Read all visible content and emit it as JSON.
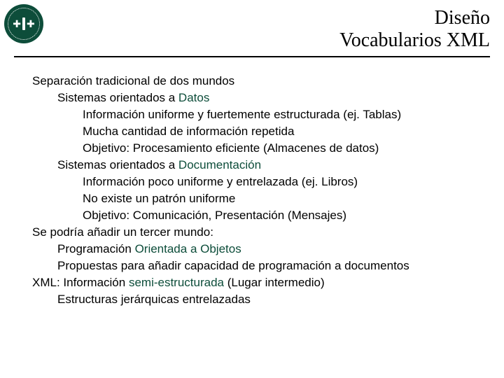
{
  "title_line_1": "Diseño",
  "title_line_2": "Vocabularios XML",
  "lines": [
    {
      "level": 0,
      "pre": "Separación tradicional de dos mundos",
      "kw": "",
      "post": ""
    },
    {
      "level": 1,
      "pre": "Sistemas orientados a ",
      "kw": "Datos",
      "post": ""
    },
    {
      "level": 2,
      "pre": "Información uniforme y fuertemente estructurada (ej. Tablas)",
      "kw": "",
      "post": ""
    },
    {
      "level": 2,
      "pre": "Mucha cantidad de información repetida",
      "kw": "",
      "post": ""
    },
    {
      "level": 2,
      "pre": "Objetivo: Procesamiento eficiente (Almacenes de datos)",
      "kw": "",
      "post": ""
    },
    {
      "level": 1,
      "pre": "Sistemas orientados a ",
      "kw": "Documentación",
      "post": ""
    },
    {
      "level": 2,
      "pre": "Información poco uniforme y entrelazada (ej. Libros)",
      "kw": "",
      "post": ""
    },
    {
      "level": 2,
      "pre": "No existe un patrón uniforme",
      "kw": "",
      "post": ""
    },
    {
      "level": 2,
      "pre": "Objetivo: Comunicación, Presentación  (Mensajes)",
      "kw": "",
      "post": ""
    },
    {
      "level": 0,
      "pre": "Se podría añadir un tercer mundo:",
      "kw": "",
      "post": ""
    },
    {
      "level": 1,
      "pre": "Programación ",
      "kw": "Orientada a Objetos",
      "post": ""
    },
    {
      "level": 1,
      "pre": "Propuestas para añadir capacidad de programación a documentos",
      "kw": "",
      "post": ""
    },
    {
      "level": 0,
      "pre": "XML: Información ",
      "kw": "semi-estructurada",
      "post": " (Lugar intermedio)"
    },
    {
      "level": 1,
      "pre": "Estructuras jerárquicas entrelazadas",
      "kw": "",
      "post": ""
    }
  ]
}
